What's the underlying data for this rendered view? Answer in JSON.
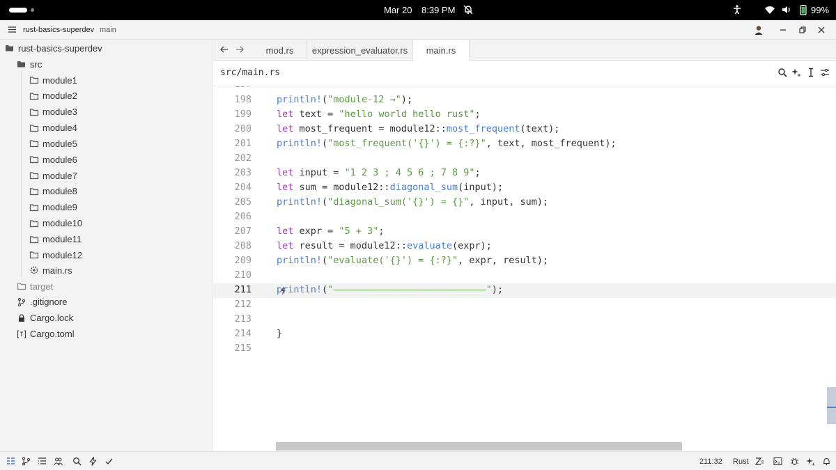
{
  "system_bar": {
    "date": "Mar 20",
    "time": "8:39 PM",
    "battery": "99%"
  },
  "titlebar": {
    "project": "rust-basics-superdev",
    "branch": "main"
  },
  "sidebar": {
    "root": "rust-basics-superdev",
    "src": "src",
    "modules": [
      "module1",
      "module2",
      "module3",
      "module4",
      "module5",
      "module6",
      "module7",
      "module8",
      "module9",
      "module10",
      "module11",
      "module12"
    ],
    "main_file": "main.rs",
    "others": [
      {
        "label": "target",
        "icon": "folder-icon",
        "dim": true
      },
      {
        "label": ".gitignore",
        "icon": "git-icon",
        "dim": false
      },
      {
        "label": "Cargo.lock",
        "icon": "lock-icon",
        "dim": false
      },
      {
        "label": "Cargo.toml",
        "icon": "toml-icon",
        "dim": false
      }
    ]
  },
  "tabs": [
    {
      "label": "mod.rs",
      "active": false
    },
    {
      "label": "expression_evaluator.rs",
      "active": false
    },
    {
      "label": "main.rs",
      "active": true
    }
  ],
  "editor": {
    "path": "src/main.rs",
    "lines": [
      {
        "n": "198",
        "code": [
          [
            "f",
            "println!"
          ],
          [
            "p",
            "("
          ],
          [
            "s",
            "\"module-12 →\""
          ],
          [
            "p",
            ");"
          ]
        ]
      },
      {
        "n": "199",
        "code": [
          [
            "k",
            "let"
          ],
          [
            "p",
            " text = "
          ],
          [
            "s",
            "\"hello world hello rust\""
          ],
          [
            "p",
            ";"
          ]
        ]
      },
      {
        "n": "200",
        "code": [
          [
            "k",
            "let"
          ],
          [
            "p",
            " most_frequent = module12::"
          ],
          [
            "f",
            "most_frequent"
          ],
          [
            "p",
            "(text);"
          ]
        ]
      },
      {
        "n": "201",
        "code": [
          [
            "f",
            "println!"
          ],
          [
            "p",
            "("
          ],
          [
            "s",
            "\"most_frequent('{}') = {:?}\""
          ],
          [
            "p",
            ", text, most_frequent);"
          ]
        ]
      },
      {
        "n": "202",
        "code": []
      },
      {
        "n": "203",
        "code": [
          [
            "k",
            "let"
          ],
          [
            "p",
            " input = "
          ],
          [
            "s",
            "\"1 2 3 ; 4 5 6 ; 7 8 9\""
          ],
          [
            "p",
            ";"
          ]
        ]
      },
      {
        "n": "204",
        "code": [
          [
            "k",
            "let"
          ],
          [
            "p",
            " sum = module12::"
          ],
          [
            "f",
            "diagonal_sum"
          ],
          [
            "p",
            "(input);"
          ]
        ]
      },
      {
        "n": "205",
        "code": [
          [
            "f",
            "println!"
          ],
          [
            "p",
            "("
          ],
          [
            "s",
            "\"diagonal_sum('{}') = {}\""
          ],
          [
            "p",
            ", input, sum);"
          ]
        ]
      },
      {
        "n": "206",
        "code": []
      },
      {
        "n": "207",
        "code": [
          [
            "k",
            "let"
          ],
          [
            "p",
            " expr = "
          ],
          [
            "s",
            "\"5 + 3\""
          ],
          [
            "p",
            ";"
          ]
        ]
      },
      {
        "n": "208",
        "code": [
          [
            "k",
            "let"
          ],
          [
            "p",
            " result = module12::"
          ],
          [
            "f",
            "evaluate"
          ],
          [
            "p",
            "(expr);"
          ]
        ]
      },
      {
        "n": "209",
        "code": [
          [
            "f",
            "println!"
          ],
          [
            "p",
            "("
          ],
          [
            "s",
            "\"evaluate('{}') = {:?}\""
          ],
          [
            "p",
            ", expr, result);"
          ]
        ]
      },
      {
        "n": "210",
        "code": []
      },
      {
        "n": "211",
        "code": [
          [
            "f",
            "println!"
          ],
          [
            "p",
            "("
          ],
          [
            "s",
            "\"———————————————————————————\""
          ],
          [
            "p",
            ");"
          ]
        ]
      },
      {
        "n": "212",
        "code": []
      },
      {
        "n": "213",
        "code": []
      },
      {
        "n": "214",
        "code": [
          [
            "p",
            "}"
          ]
        ]
      },
      {
        "n": "215",
        "code": []
      }
    ],
    "current_line": "211"
  },
  "statusbar": {
    "position": "211:32",
    "language": "Rust"
  }
}
